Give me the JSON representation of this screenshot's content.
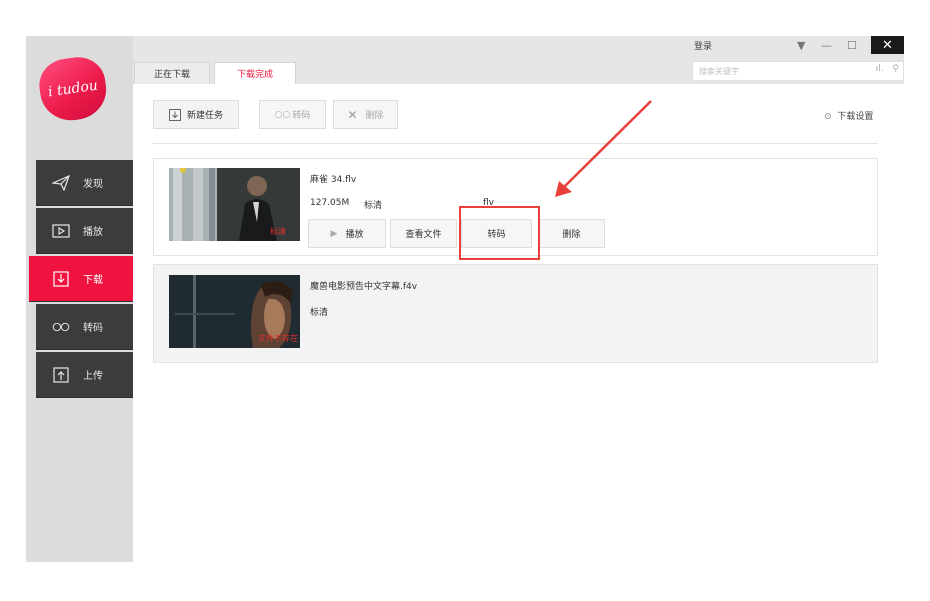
{
  "app": {
    "logo_text": "i tudou"
  },
  "titlebar": {
    "login": "登录",
    "search_placeholder": "搜索关键字",
    "controls": {
      "dropdown": "▼",
      "minimize": "—",
      "maximize": "☐",
      "close": "✕"
    }
  },
  "tabs": [
    {
      "label": "正在下载",
      "active": false
    },
    {
      "label": "下载完成",
      "active": true
    }
  ],
  "toolbar": {
    "new_task": "新建任务",
    "transcode": "转码",
    "delete": "删除",
    "settings": "下载设置"
  },
  "sidebar": {
    "items": [
      {
        "label": "发现",
        "icon": "send-icon"
      },
      {
        "label": "播放",
        "icon": "play-icon"
      },
      {
        "label": "下载",
        "icon": "download-icon",
        "active": true
      },
      {
        "label": "转码",
        "icon": "infinity-icon"
      },
      {
        "label": "上传",
        "icon": "upload-icon"
      }
    ]
  },
  "downloads": [
    {
      "title": "麻雀 34.flv",
      "size": "127.05M",
      "quality": "标清",
      "format": "flv",
      "thumb_badge": "标清",
      "actions": {
        "play": "播放",
        "view_file": "查看文件",
        "transcode": "转码",
        "delete": "删除"
      }
    },
    {
      "title": "魔兽电影预告中文字幕.f4v",
      "quality": "标清",
      "thumb_badge": "文件不存在"
    }
  ],
  "colors": {
    "accent": "#f0133f",
    "sidebar_dark": "#3c3c3c",
    "annotation": "#e8413a"
  }
}
